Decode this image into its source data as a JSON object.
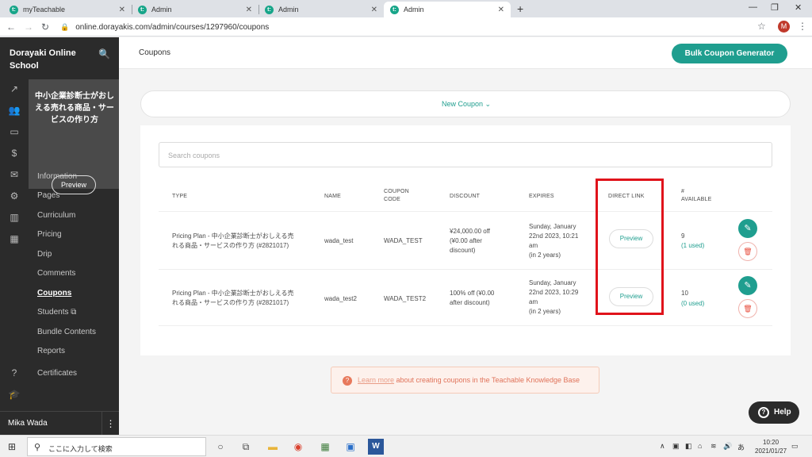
{
  "browser": {
    "tabs": [
      {
        "label": "myTeachable",
        "favicon": "t:"
      },
      {
        "label": "Admin",
        "favicon": "t:"
      },
      {
        "label": "Admin",
        "favicon": "t:"
      },
      {
        "label": "Admin",
        "favicon": "t:"
      }
    ],
    "url": "online.dorayakis.com/admin/courses/1297960/coupons",
    "profile_initial": "M"
  },
  "sidebar": {
    "school_name": "Dorayaki Online School",
    "course_title": "中小企業診断士がおしえる売れる商品・サービスの作り方",
    "course_preview_label": "Preview",
    "menu": [
      {
        "label": "Information"
      },
      {
        "label": "Pages"
      },
      {
        "label": "Curriculum"
      },
      {
        "label": "Pricing"
      },
      {
        "label": "Drip"
      },
      {
        "label": "Comments"
      },
      {
        "label": "Coupons"
      },
      {
        "label": "Students ⧉"
      },
      {
        "label": "Bundle Contents"
      },
      {
        "label": "Reports"
      },
      {
        "label": "Certificates"
      }
    ],
    "user_name": "Mika Wada"
  },
  "header": {
    "title": "Coupons",
    "bulk_button": "Bulk Coupon Generator"
  },
  "main": {
    "new_coupon": "New Coupon ⌄",
    "search_placeholder": "Search coupons",
    "columns": {
      "type": "TYPE",
      "name": "NAME",
      "code": "COUPON CODE",
      "discount": "DISCOUNT",
      "expires": "EXPIRES",
      "direct_link": "DIRECT LINK",
      "available": "# AVAILABLE"
    },
    "rows": [
      {
        "type": "Pricing Plan - 中小企業診断士がおしえる売れる商品・サービスの作り方 (#2821017)",
        "name": "wada_test",
        "code": "WADA_TEST",
        "discount": "¥24,000.00 off (¥0.00 after discount)",
        "expires": "Sunday, January 22nd 2023, 10:21 am",
        "expires_rel": "(in 2 years)",
        "preview": "Preview",
        "available": "9",
        "used": "(1 used)"
      },
      {
        "type": "Pricing Plan - 中小企業診断士がおしえる売れる商品・サービスの作り方 (#2821017)",
        "name": "wada_test2",
        "code": "WADA_TEST2",
        "discount": "100% off (¥0.00 after discount)",
        "expires": "Sunday, January 22nd 2023, 10:29 am",
        "expires_rel": "(in 2 years)",
        "preview": "Preview",
        "available": "10",
        "used": "(0 used)"
      }
    ],
    "kb_link": "Learn more",
    "kb_text": " about creating coupons in the Teachable Knowledge Base",
    "help_label": "Help"
  },
  "taskbar": {
    "search_text": "ここに入力して検索",
    "time": "10:20",
    "date": "2021/01/27"
  }
}
